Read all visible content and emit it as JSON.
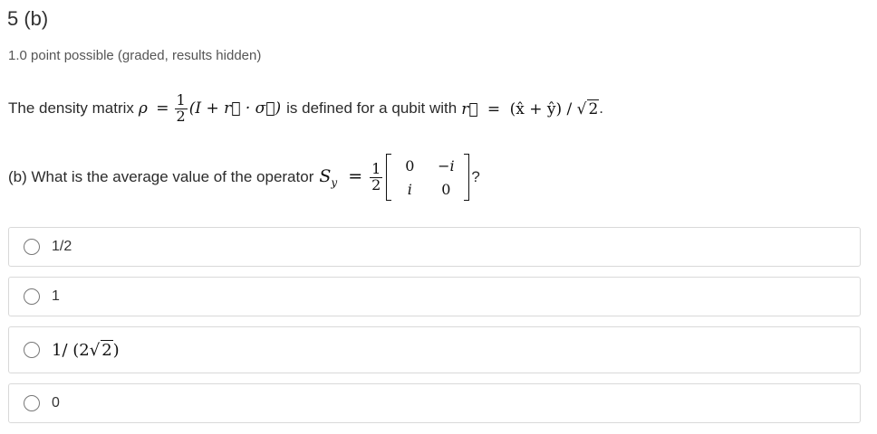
{
  "problem": {
    "title": "5 (b)",
    "progress": "1.0 point possible (graded, results hidden)"
  },
  "prompt": {
    "line1_prefix": "The density matrix",
    "line1_middle": "is defined for a qubit with",
    "line1_suffix": ".",
    "line2_prefix": "(b) What is the average value of the operator",
    "line2_suffix": "?",
    "math": {
      "rho": "ρ",
      "eq": "=",
      "one": "1",
      "two": "2",
      "density_expr": "(I + r⃗ · σ⃗)",
      "r_vec": "r⃗",
      "r_expr_open": "(x̂ + ŷ) /",
      "sqrt2": "2",
      "S": "S",
      "sub_y": "y",
      "matrix": [
        "0",
        "−i",
        "i",
        "0"
      ]
    }
  },
  "choices": [
    {
      "label": "1/2"
    },
    {
      "label": "1"
    },
    {
      "label_prefix": "1/ (2",
      "label_radicand": "2",
      "label_suffix": ")"
    },
    {
      "label": "0"
    }
  ]
}
